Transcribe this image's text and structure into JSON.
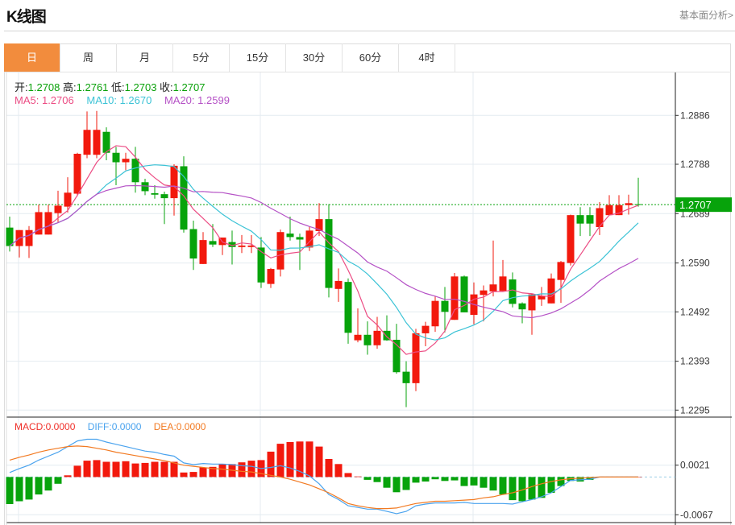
{
  "header": {
    "title": "K线图",
    "link": "基本面分析>"
  },
  "tabs": [
    {
      "label": "日",
      "active": true
    },
    {
      "label": "周"
    },
    {
      "label": "月"
    },
    {
      "label": "5分"
    },
    {
      "label": "15分"
    },
    {
      "label": "30分"
    },
    {
      "label": "60分"
    },
    {
      "label": "4时"
    }
  ],
  "info": {
    "open_label": "开:",
    "open": "1.2708",
    "high_label": "高:",
    "high": "1.2761",
    "low_label": "低:",
    "low": "1.2703",
    "close_label": "收:",
    "close": "1.2707",
    "ma5_label": "MA5:",
    "ma5": "1.2706",
    "ma10_label": "MA10:",
    "ma10": "1.2670",
    "ma20_label": "MA20:",
    "ma20": "1.2599",
    "macd_label": "MACD:",
    "macd": "0.0000",
    "diff_label": "DIFF:",
    "diff": "0.0000",
    "dea_label": "DEA:",
    "dea": "0.0000"
  },
  "colors": {
    "up": "#f2190d",
    "down": "#07a30b",
    "ma5": "#ec4d84",
    "ma10": "#3cc3d6",
    "ma20": "#b552c6",
    "diff": "#4aa3ee",
    "dea": "#f27a22",
    "current": "#07a30b"
  },
  "chart_data": [
    {
      "type": "candlestick",
      "title": "K线图",
      "ylim": [
        1.2295,
        1.2886
      ],
      "yticks": [
        "1.2886",
        "1.2788",
        "1.2689",
        "1.2590",
        "1.2492",
        "1.2393",
        "1.2295"
      ],
      "current_price": "1.2707",
      "grid": true,
      "ohlc": [
        [
          1.2661,
          1.2683,
          1.2613,
          1.2624
        ],
        [
          1.2624,
          1.2656,
          1.2601,
          1.2656
        ],
        [
          1.2624,
          1.2664,
          1.26,
          1.2656
        ],
        [
          1.2647,
          1.2707,
          1.2647,
          1.2692
        ],
        [
          1.2647,
          1.2707,
          1.2647,
          1.2692
        ],
        [
          1.269,
          1.2735,
          1.2672,
          1.2705
        ],
        [
          1.2703,
          1.2762,
          1.2691,
          1.2731
        ],
        [
          1.2729,
          1.2811,
          1.2724,
          1.2809
        ],
        [
          1.2807,
          1.2894,
          1.28,
          1.2857
        ],
        [
          1.2807,
          1.2895,
          1.28,
          1.2857
        ],
        [
          1.2853,
          1.2862,
          1.2796,
          1.2811
        ],
        [
          1.2811,
          1.2823,
          1.2746,
          1.2792
        ],
        [
          1.2792,
          1.2811,
          1.2776,
          1.2799
        ],
        [
          1.2799,
          1.2823,
          1.2731,
          1.2752
        ],
        [
          1.2752,
          1.2759,
          1.2726,
          1.2734
        ],
        [
          1.273,
          1.2746,
          1.2719,
          1.2727
        ],
        [
          1.2728,
          1.2733,
          1.2668,
          1.272
        ],
        [
          1.272,
          1.2788,
          1.2685,
          1.2785
        ],
        [
          1.2784,
          1.2804,
          1.2651,
          1.2657
        ],
        [
          1.2658,
          1.2675,
          1.2576,
          1.2599
        ],
        [
          1.2588,
          1.2652,
          1.2588,
          1.2636
        ],
        [
          1.2634,
          1.2668,
          1.2622,
          1.2627
        ],
        [
          1.2626,
          1.2641,
          1.2606,
          1.2641
        ],
        [
          1.2632,
          1.2655,
          1.2587,
          1.2622
        ],
        [
          1.2622,
          1.2646,
          1.261,
          1.2625
        ],
        [
          1.2622,
          1.2646,
          1.261,
          1.2625
        ],
        [
          1.2621,
          1.2642,
          1.254,
          1.2551
        ],
        [
          1.2548,
          1.258,
          1.254,
          1.2578
        ],
        [
          1.2577,
          1.2657,
          1.2563,
          1.2652
        ],
        [
          1.2649,
          1.2683,
          1.2635,
          1.2642
        ],
        [
          1.2642,
          1.2649,
          1.2576,
          1.2637
        ],
        [
          1.2621,
          1.2663,
          1.2614,
          1.2655
        ],
        [
          1.2654,
          1.271,
          1.2644,
          1.2678
        ],
        [
          1.2678,
          1.2708,
          1.2521,
          1.254
        ],
        [
          1.2538,
          1.2579,
          1.2512,
          1.2554
        ],
        [
          1.2552,
          1.2559,
          1.2428,
          1.245
        ],
        [
          1.2435,
          1.2499,
          1.2431,
          1.2446
        ],
        [
          1.2446,
          1.2473,
          1.2406,
          1.2425
        ],
        [
          1.2425,
          1.2482,
          1.2418,
          1.2454
        ],
        [
          1.2454,
          1.2485,
          1.2434,
          1.2435
        ],
        [
          1.2436,
          1.2468,
          1.2368,
          1.2371
        ],
        [
          1.2372,
          1.2393,
          1.2301,
          1.2349
        ],
        [
          1.2349,
          1.2458,
          1.2333,
          1.2449
        ],
        [
          1.2449,
          1.2472,
          1.2423,
          1.2464
        ],
        [
          1.2463,
          1.2524,
          1.2452,
          1.2514
        ],
        [
          1.2514,
          1.2542,
          1.2451,
          1.2492
        ],
        [
          1.2476,
          1.257,
          1.2476,
          1.2563
        ],
        [
          1.2563,
          1.2565,
          1.2491,
          1.2491
        ],
        [
          1.2486,
          1.2551,
          1.2467,
          1.2527
        ],
        [
          1.2526,
          1.2545,
          1.2473,
          1.2535
        ],
        [
          1.2533,
          1.2635,
          1.2523,
          1.2547
        ],
        [
          1.2534,
          1.2596,
          1.2534,
          1.2563
        ],
        [
          1.2557,
          1.2571,
          1.2501,
          1.2508
        ],
        [
          1.2509,
          1.2511,
          1.2469,
          1.2497
        ],
        [
          1.2495,
          1.2528,
          1.2446,
          1.2527
        ],
        [
          1.2517,
          1.2542,
          1.2504,
          1.2524
        ],
        [
          1.2509,
          1.2569,
          1.2509,
          1.2559
        ],
        [
          1.2556,
          1.2594,
          1.251,
          1.2592
        ],
        [
          1.259,
          1.2687,
          1.2585,
          1.2686
        ],
        [
          1.2686,
          1.2702,
          1.2644,
          1.2669
        ],
        [
          1.2686,
          1.2702,
          1.2644,
          1.2669
        ],
        [
          1.2662,
          1.2712,
          1.2646,
          1.27
        ],
        [
          1.2686,
          1.2726,
          1.2686,
          1.2706
        ],
        [
          1.2686,
          1.2726,
          1.2686,
          1.2706
        ],
        [
          1.2706,
          1.2727,
          1.2687,
          1.271
        ],
        [
          1.2708,
          1.2761,
          1.2703,
          1.2707
        ]
      ],
      "series": [
        {
          "name": "MA5",
          "period": 5
        },
        {
          "name": "MA10",
          "period": 10
        },
        {
          "name": "MA20",
          "period": 20
        }
      ]
    },
    {
      "type": "bar+line",
      "title": "MACD",
      "ylim": [
        -0.0067,
        0.0021
      ],
      "yticks": [
        "0.0021",
        "-0.0067"
      ],
      "macd": [
        -0.0048,
        -0.0043,
        -0.004,
        -0.0031,
        -0.0024,
        -0.0012,
        0.0003,
        0.002,
        0.0029,
        0.003,
        0.0027,
        0.0027,
        0.0028,
        0.0024,
        0.0025,
        0.0027,
        0.0027,
        0.0027,
        0.0008,
        0.0009,
        0.0017,
        0.0018,
        0.0023,
        0.0023,
        0.0026,
        0.0029,
        0.003,
        0.0045,
        0.0059,
        0.0062,
        0.0063,
        0.0063,
        0.0054,
        0.0032,
        0.0023,
        0.0007,
        0.0001,
        -0.0005,
        -0.0009,
        -0.0019,
        -0.0027,
        -0.0023,
        -0.001,
        -0.0008,
        -0.0004,
        -0.0007,
        -0.0006,
        -0.0016,
        -0.0015,
        -0.0019,
        -0.0024,
        -0.0031,
        -0.0041,
        -0.0043,
        -0.004,
        -0.0037,
        -0.0028,
        -0.0016,
        -0.0007,
        -0.0008,
        -0.0005,
        0,
        0,
        0,
        0,
        0
      ],
      "diff": [
        0.0008,
        0.0015,
        0.0021,
        0.003,
        0.0037,
        0.0044,
        0.0054,
        0.0064,
        0.0067,
        0.0067,
        0.0062,
        0.0058,
        0.0054,
        0.005,
        0.0046,
        0.0044,
        0.004,
        0.0037,
        0.0025,
        0.0022,
        0.0024,
        0.0023,
        0.0023,
        0.0022,
        0.002,
        0.0019,
        0.0015,
        0.0017,
        0.002,
        0.0016,
        0.001,
        0.0002,
        -0.0012,
        -0.0031,
        -0.004,
        -0.0051,
        -0.0054,
        -0.0057,
        -0.0057,
        -0.0061,
        -0.0065,
        -0.0061,
        -0.0051,
        -0.0048,
        -0.0046,
        -0.0046,
        -0.0046,
        -0.0045,
        -0.0047,
        -0.0047,
        -0.0047,
        -0.0047,
        -0.0048,
        -0.0044,
        -0.004,
        -0.0035,
        -0.0028,
        -0.0017,
        -0.0006,
        -0.0005,
        -0.0004,
        0,
        0,
        0,
        0,
        0
      ],
      "dea": [
        0.003,
        0.0035,
        0.0039,
        0.0044,
        0.0048,
        0.0051,
        0.0054,
        0.0055,
        0.0054,
        0.0051,
        0.0048,
        0.0044,
        0.0041,
        0.0038,
        0.0035,
        0.0032,
        0.0029,
        0.0025,
        0.0021,
        0.0019,
        0.0017,
        0.0015,
        0.0014,
        0.0012,
        0.001,
        0.0009,
        0.0006,
        0.0003,
        0,
        -0.0004,
        -0.0009,
        -0.0014,
        -0.0021,
        -0.0028,
        -0.0037,
        -0.0047,
        -0.0051,
        -0.0054,
        -0.0056,
        -0.0056,
        -0.0055,
        -0.0051,
        -0.0047,
        -0.0045,
        -0.0043,
        -0.0043,
        -0.0042,
        -0.0041,
        -0.004,
        -0.0037,
        -0.0035,
        -0.0031,
        -0.0028,
        -0.0023,
        -0.0017,
        -0.0012,
        -0.0008,
        -0.0005,
        -0.0003,
        -0.0002,
        -0.0001,
        0,
        0,
        0,
        0,
        0
      ]
    }
  ]
}
